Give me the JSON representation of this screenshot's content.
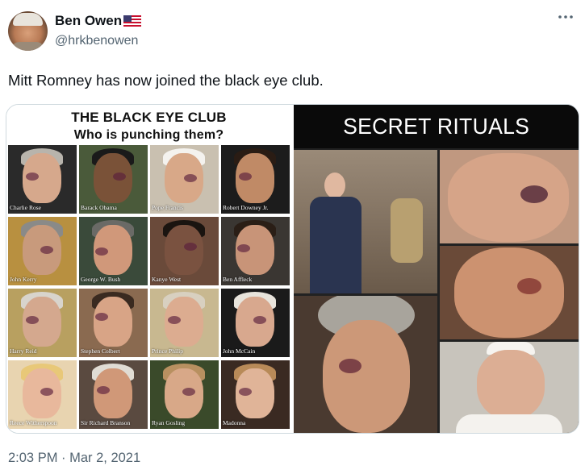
{
  "user": {
    "display_name": "Ben Owen",
    "flag_emoji": "🇺🇸",
    "handle": "@hrkbenowen"
  },
  "tweet": {
    "text": "Mitt Romney has now joined the black eye club.",
    "timestamp": "2:03 PM · Mar 2, 2021"
  },
  "icons": {
    "more": "more-horizontal-icon",
    "avatar": "avatar-photo"
  },
  "media": {
    "left": {
      "title": "THE BLACK EYE CLUB",
      "subtitle": "Who is punching them?",
      "people": [
        "Charlie Rose",
        "Barack Obama",
        "Pope Francis",
        "Robert Downey Jr.",
        "John Kerry",
        "George W. Bush",
        "Kanye West",
        "Ben Affleck",
        "Harry Reid",
        "Stephen Colbert",
        "Prince Philip",
        "John McCain",
        "Reece Witherspoon",
        "Sir Richard Branson",
        "Ryan Gosling",
        "Madonna"
      ]
    },
    "right": {
      "title": "SECRET RITUALS"
    }
  },
  "colors": {
    "text_primary": "#0f1419",
    "text_secondary": "#536471",
    "border": "#cfd9de"
  }
}
